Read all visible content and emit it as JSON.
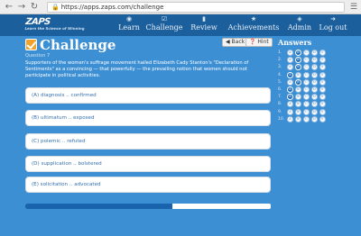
{
  "browser": {
    "back_icon": "back-arrow-icon",
    "forward_icon": "forward-arrow-icon",
    "reload_icon": "reload-icon",
    "url": "https://apps.zaps.com/challenge"
  },
  "app": {
    "logo_text": "ZAPS",
    "logo_tagline": "Learn the Science of Winning",
    "nav": [
      {
        "label": "Learn",
        "icon": "lightbulb-icon"
      },
      {
        "label": "Challenge",
        "icon": "checkbox-icon"
      },
      {
        "label": "Review",
        "icon": "book-icon"
      },
      {
        "label": "Achievements",
        "icon": "star-icon"
      },
      {
        "label": "Admin",
        "icon": "lock-icon"
      },
      {
        "label": "Log out",
        "icon": "logout-icon"
      }
    ]
  },
  "challenge": {
    "title": "Challenge",
    "question_label": "Question 7",
    "back_label": "Back",
    "hint_label": "Hint",
    "prompt": "Supporters of the women's suffrage movement hailed Elizabeth Cady Stanton's \"Declaration of Sentiments\" as a convincing — that powerfully — the prevailing notion that women should not participate in political activities.",
    "options": [
      "(A) diagnosis .. confirmed",
      "(B) ultimatum .. exposed",
      "(C) polemic .. refuted",
      "(D) supplication .. bolstered",
      "(E) solicitation .. advocated"
    ],
    "progress_fraction": 0.6
  },
  "answers": {
    "title": "Answers",
    "choice_letters": [
      "A",
      "B",
      "C",
      "D",
      "E"
    ],
    "rows": [
      {
        "num": "1.",
        "selected": 1
      },
      {
        "num": "2.",
        "selected": 1
      },
      {
        "num": "3.",
        "selected": 1
      },
      {
        "num": "4.",
        "selected": 0
      },
      {
        "num": "5.",
        "selected": 1
      },
      {
        "num": "6.",
        "selected": 0
      },
      {
        "num": "7.",
        "selected": 0
      },
      {
        "num": "8.",
        "selected": -1
      },
      {
        "num": "9.",
        "selected": -1
      },
      {
        "num": "10.",
        "selected": -1
      }
    ]
  },
  "colors": {
    "background": "#3d8fd4",
    "appbar": "#1b5f9d",
    "accent": "#f0a22a",
    "selected_dot": "#1e6bb8"
  }
}
